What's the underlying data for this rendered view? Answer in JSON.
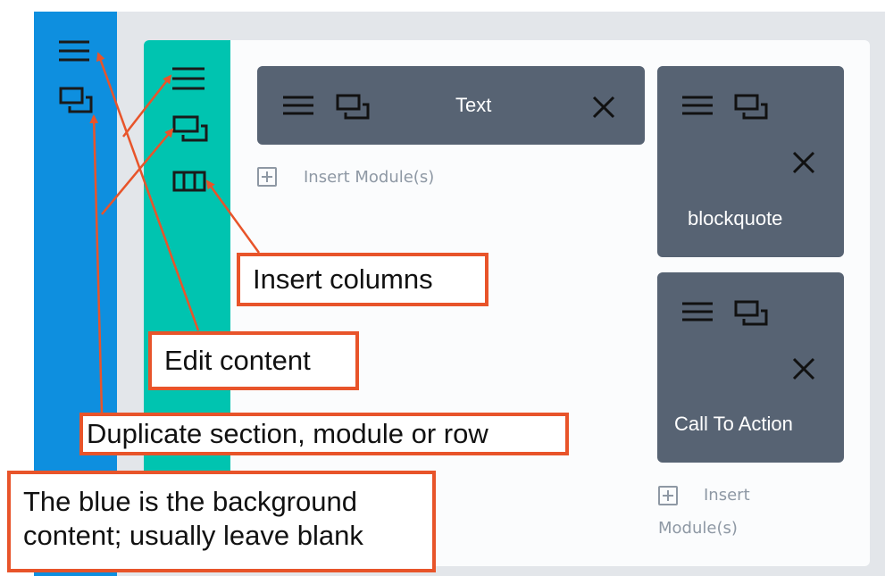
{
  "builder": {
    "modules": {
      "text": {
        "label": "Text"
      },
      "blockquote": {
        "label": "blockquote"
      },
      "cta": {
        "label": "Call To Action"
      }
    },
    "insert_module_label": "Insert Module(s)",
    "insert_module_label_line1": "Insert",
    "insert_module_label_line2": "Module(s)"
  },
  "annotations": {
    "insert_columns": "Insert columns",
    "edit_content": "Edit content",
    "duplicate": "Duplicate section, module or row",
    "background_line1": "The blue is the background",
    "background_line2": "content; usually leave blank"
  },
  "colors": {
    "section": "#0e8fdf",
    "row": "#00c4b0",
    "module": "#576373",
    "annotation_border": "#e8542a"
  },
  "icons": [
    "hamburger-menu-icon",
    "duplicate-icon",
    "columns-icon",
    "close-icon",
    "plus-box-icon"
  ]
}
